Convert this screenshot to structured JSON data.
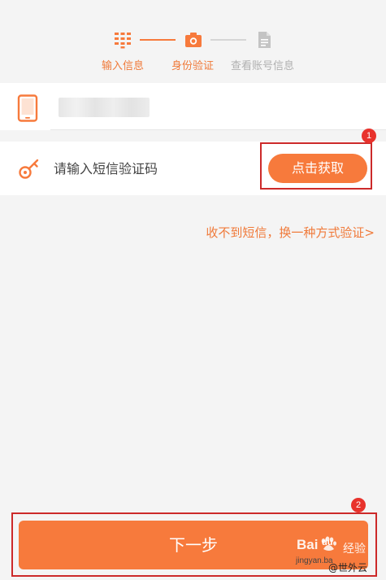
{
  "stepper": {
    "steps": [
      {
        "label": "输入信息",
        "icon": "keypad-icon",
        "state": "done"
      },
      {
        "label": "身份验证",
        "icon": "camera-icon",
        "state": "active"
      },
      {
        "label": "查看账号信息",
        "icon": "document-icon",
        "state": "pending"
      }
    ]
  },
  "phone": {
    "icon": "phone-icon",
    "value": ""
  },
  "sms": {
    "icon": "key-icon",
    "placeholder": "请输入短信验证码",
    "get_code_label": "点击获取"
  },
  "alt_link": "收不到短信，换一种方式验证>",
  "next_label": "下一步",
  "annotations": [
    "1",
    "2"
  ],
  "watermark": {
    "brand_bai": "Bai",
    "brand_du": "du",
    "brand_jingyan": "经验",
    "url": "jingyan.ba",
    "source": "@世外云"
  },
  "colors": {
    "accent": "#f77a3c",
    "accent_text": "#f07a3a",
    "pending": "#bbbbbb",
    "annotation": "#cc2a2a",
    "background": "#f4f4f4"
  }
}
